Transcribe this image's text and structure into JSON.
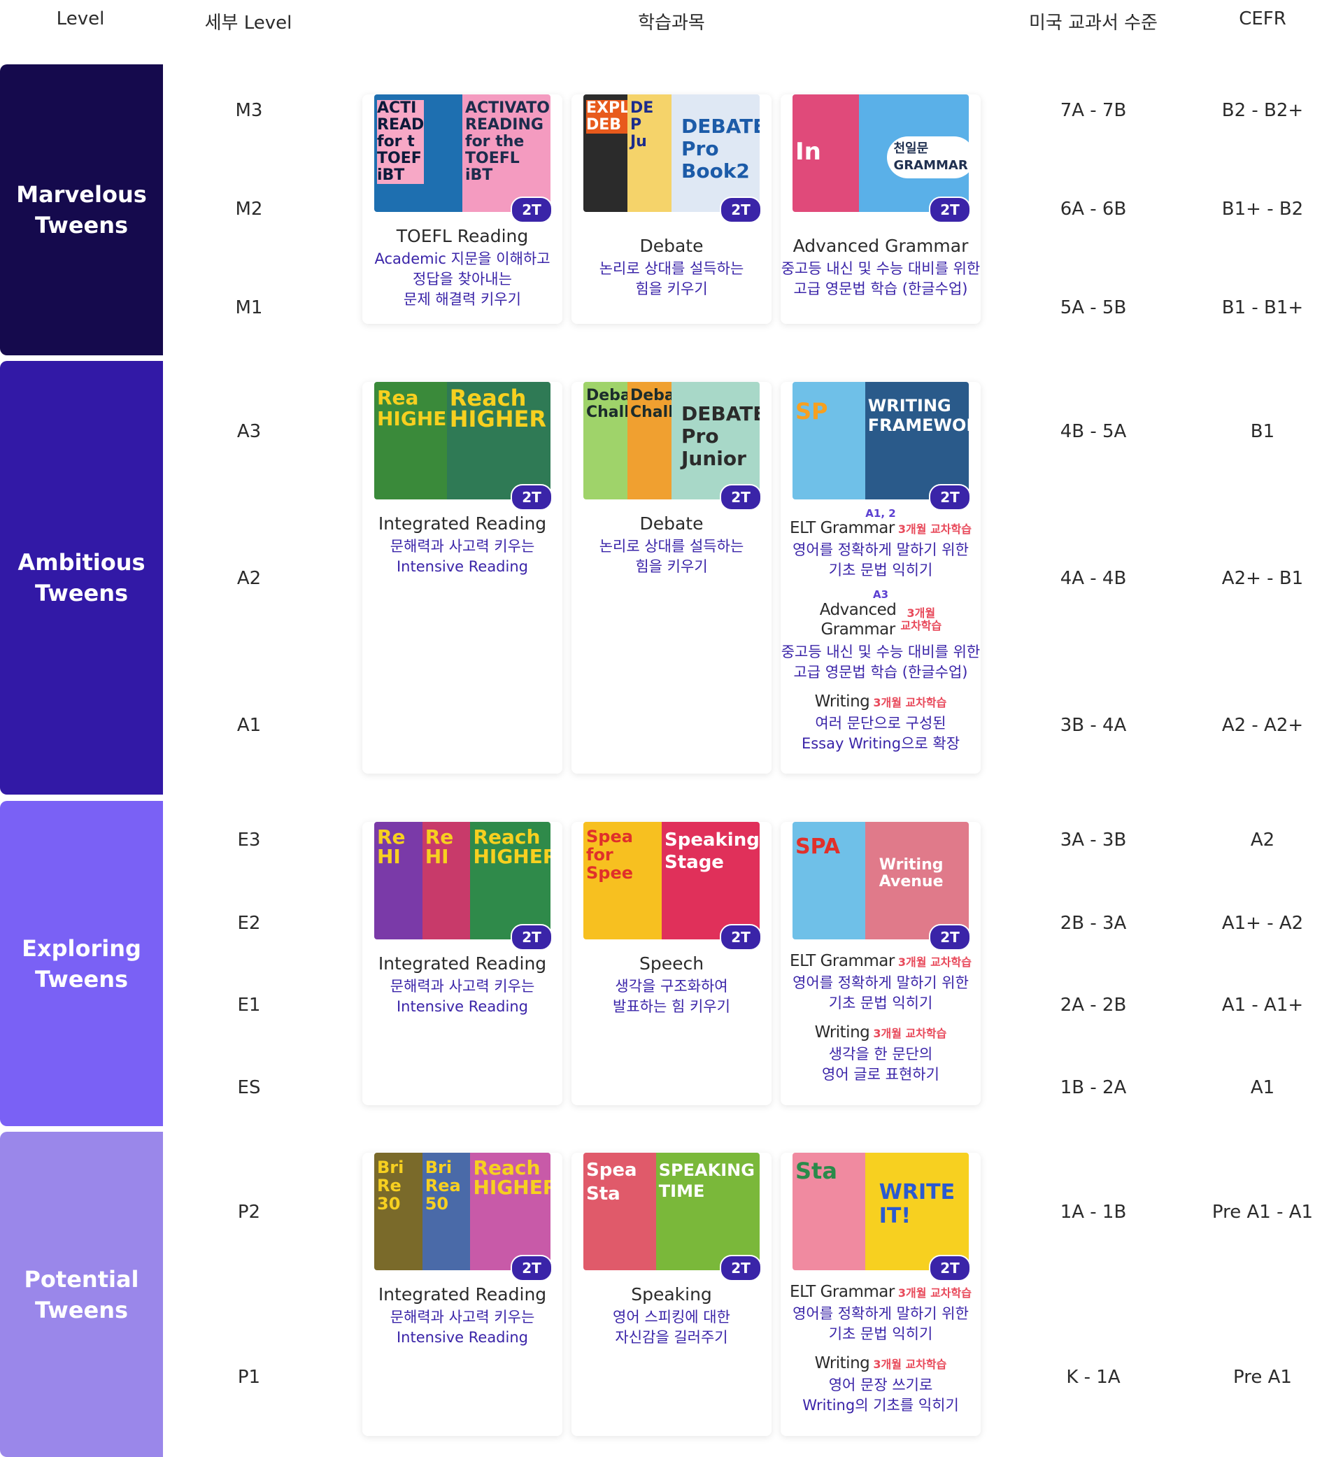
{
  "headers": {
    "level": "Level",
    "sub_level": "세부 Level",
    "subjects": "학습과목",
    "us_textbook": "미국 교과서 수준",
    "cefr": "CEFR"
  },
  "colors": {
    "marvelous": "#150a4d",
    "ambitious": "#3219a6",
    "exploring": "#7a61f5",
    "potential": "#9a87ea",
    "accent_text": "#3a24a8",
    "tag_red": "#e8495a"
  },
  "bands": [
    {
      "name": "Marvelous\nTweens"
    },
    {
      "name": "Ambitious\nTweens"
    },
    {
      "name": "Exploring\nTweens"
    },
    {
      "name": "Potential\nTweens"
    }
  ],
  "rows": [
    {
      "level": "M3",
      "us": "7A - 7B",
      "cefr": "B2 - B2+"
    },
    {
      "level": "M2",
      "us": "6A - 6B",
      "cefr": "B1+ - B2"
    },
    {
      "level": "M1",
      "us": "5A - 5B",
      "cefr": "B1 - B1+"
    },
    {
      "level": "A3",
      "us": "4B - 5A",
      "cefr": "B1"
    },
    {
      "level": "A2",
      "us": "4A - 4B",
      "cefr": "A2+ - B1"
    },
    {
      "level": "A1",
      "us": "3B - 4A",
      "cefr": "A2 - A2+"
    },
    {
      "level": "E3",
      "us": "3A - 3B",
      "cefr": "A2"
    },
    {
      "level": "E2",
      "us": "2B -  3A",
      "cefr": "A1+ - A2"
    },
    {
      "level": "E1",
      "us": "2A - 2B",
      "cefr": "A1 - A1+"
    },
    {
      "level": "ES",
      "us": "1B - 2A",
      "cefr": "A1"
    },
    {
      "level": "P2",
      "us": "1A - 1B",
      "cefr": "Pre A1 - A1"
    },
    {
      "level": "P1",
      "us": "K - 1A",
      "cefr": "Pre A1"
    }
  ],
  "badge": "2T",
  "cards": {
    "m_reading": {
      "title": "TOEFL Reading",
      "desc": "Academic 지문을 이해하고\n정답을 찾아내는\n문제 해결력 키우기",
      "covers": [
        "ACTI\nREAD\nfor t\nTOEF\niBT",
        "ACTIVATOR\nREADING\nfor the\nTOEFL\niBT"
      ]
    },
    "m_debate": {
      "title": "Debate",
      "desc": "논리로 상대를 설득하는\n힘을 키우기",
      "covers": [
        "EXPLO\nDEB",
        "DE\nP\nJu",
        "DEBATE\nPro\nBook2"
      ]
    },
    "m_grammar": {
      "title": "Advanced Grammar",
      "desc": "중고등 내신 및 수능 대비를 위한\n고급 영문법 학습 (한글수업)",
      "covers": [
        "In",
        "천일문\nGRAMMAR"
      ]
    },
    "a_reading": {
      "title": "Integrated Reading",
      "desc": "문해력과 사고력 키우는\nIntensive Reading",
      "covers": [
        "Rea\nHIGHE",
        "Reach\nHIGHER"
      ]
    },
    "a_debate": {
      "title": "Debate",
      "desc": "논리로 상대를 설득하는\n힘을 키우기",
      "covers": [
        "Deba\nChall",
        "Deba\nChall",
        "DEBATE\nPro\nJunior"
      ]
    },
    "a_grammar": {
      "s1_sub": "A1, 2",
      "s1_title": "ELT Grammar",
      "s1_tag": "3개월 교차학습",
      "s1_desc": "영어를 정확하게 말하기 위한\n기초 문법 익히기",
      "s2_sub": "A3",
      "s2_title": "Advanced\nGrammar",
      "s2_tag": "3개월\n교차학습",
      "s2_desc": "중고등 내신 및 수능 대비를 위한\n고급 영문법 학습 (한글수업)",
      "s3_title": "Writing",
      "s3_tag": "3개월 교차학습",
      "s3_desc": "여러 문단으로 구성된\nEssay Writing으로 확장",
      "covers": [
        "SP",
        "WRITING\nFRAMEWORK"
      ]
    },
    "e_reading": {
      "title": "Integrated Reading",
      "desc": "문해력과 사고력 키우는\nIntensive Reading",
      "covers": [
        "Re\nHI",
        "Re\nHI",
        "Reach\nHIGHER"
      ]
    },
    "e_speech": {
      "title": "Speech",
      "desc": "생각을 구조화하여\n발표하는 힘 키우기",
      "covers": [
        "Spea\nfor Spee",
        "Speaking\nStage"
      ]
    },
    "e_grammar": {
      "s1_title": "ELT Grammar",
      "s1_tag": "3개월 교차학습",
      "s1_desc": "영어를 정확하게 말하기 위한\n기초 문법 익히기",
      "s3_title": "Writing",
      "s3_tag": "3개월 교차학습",
      "s3_desc": "생각을 한 문단의\n영어 글로 표현하기",
      "covers": [
        "SPA",
        "Writing\nAvenue"
      ]
    },
    "p_reading": {
      "title": "Integrated Reading",
      "desc": "문해력과 사고력 키우는\nIntensive Reading",
      "covers": [
        "Bri\nRe\n30",
        "Bri\nRea\n50",
        "Reach\nHIGHER"
      ]
    },
    "p_speaking": {
      "title": "Speaking",
      "desc": "영어 스피킹에 대한\n자신감을 길러주기",
      "covers": [
        "Spea\nSta",
        "SPEAKING\nTIME"
      ]
    },
    "p_grammar": {
      "s1_title": "ELT Grammar",
      "s1_tag": "3개월 교차학습",
      "s1_desc": "영어를 정확하게 말하기 위한\n기초 문법 익히기",
      "s3_title": "Writing",
      "s3_tag": "3개월 교차학습",
      "s3_desc": "영어 문장 쓰기로\nWriting의 기초를 익히기",
      "covers": [
        "Sta",
        "WRITE\nIT!"
      ]
    }
  }
}
